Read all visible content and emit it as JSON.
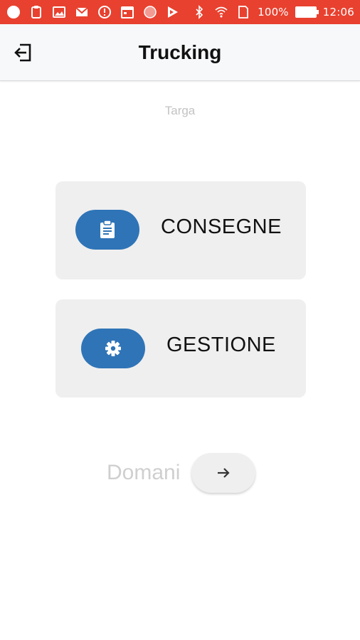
{
  "status_bar": {
    "battery_percent": "100%",
    "time": "12:06",
    "icons": [
      "circle-icon",
      "clipboard-icon",
      "image-icon",
      "gmail-icon",
      "alert-icon",
      "calendar-icon",
      "record-icon",
      "play-store-icon",
      "bluetooth-icon",
      "wifi-icon",
      "sim-icon",
      "battery-icon"
    ]
  },
  "app_bar": {
    "title": "Trucking",
    "back_icon": "exit-icon"
  },
  "plate": {
    "label": "Targa"
  },
  "menu": {
    "items": [
      {
        "label": "CONSEGNE",
        "icon": "clipboard-icon"
      },
      {
        "label": "GESTIONE",
        "icon": "gear-icon"
      }
    ]
  },
  "navigation": {
    "next_label": "Domani",
    "next_icon": "arrow-right-icon"
  },
  "colors": {
    "status_bar": "#e8412f",
    "accent": "#2f74b7",
    "card_bg": "#efefef"
  }
}
